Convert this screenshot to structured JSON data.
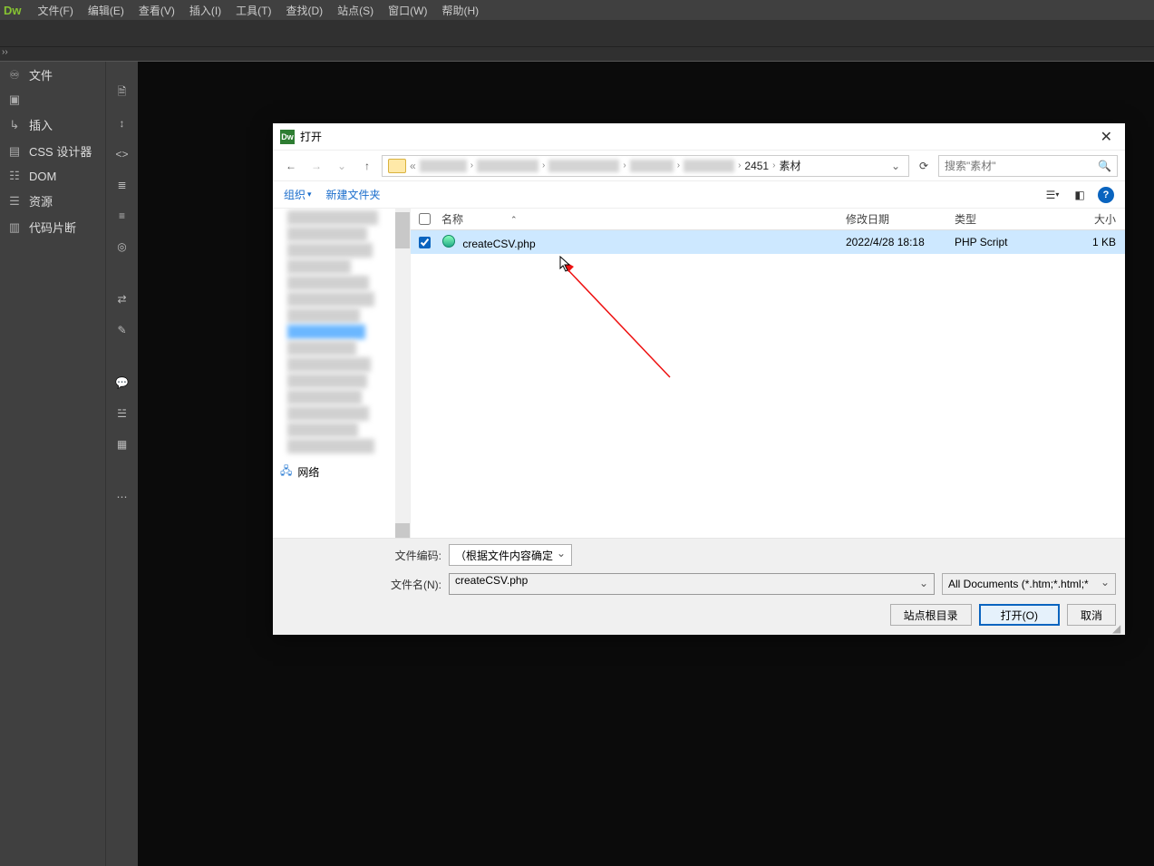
{
  "menubar": {
    "logo": "Dw",
    "items": [
      "文件(F)",
      "编辑(E)",
      "查看(V)",
      "插入(I)",
      "工具(T)",
      "查找(D)",
      "站点(S)",
      "窗口(W)",
      "帮助(H)"
    ]
  },
  "left_panel": {
    "items": [
      {
        "icon": "tree-icon",
        "label": "文件"
      },
      {
        "icon": "image-icon",
        "label": ""
      },
      {
        "icon": "insert-icon",
        "label": "插入"
      },
      {
        "icon": "css-icon",
        "label": "CSS 设计器"
      },
      {
        "icon": "dom-icon",
        "label": "DOM"
      },
      {
        "icon": "assets-icon",
        "label": "资源"
      },
      {
        "icon": "snippet-icon",
        "label": "代码片断"
      }
    ]
  },
  "dialog": {
    "title": "打开",
    "breadcrumb": {
      "part1": "2451",
      "part2": "素材"
    },
    "search_placeholder": "搜索\"素材\"",
    "toolbar": {
      "organize": "组织",
      "new_folder": "新建文件夹"
    },
    "columns": {
      "name": "名称",
      "date": "修改日期",
      "type": "类型",
      "size": "大小"
    },
    "file": {
      "name": "createCSV.php",
      "date": "2022/4/28 18:18",
      "type": "PHP Script",
      "size": "1 KB"
    },
    "tree_network": "网络",
    "encoding_label": "文件编码:",
    "encoding_value": "（根据文件内容确定",
    "filename_label": "文件名(N):",
    "filename_value": "createCSV.php",
    "filetype_value": "All Documents (*.htm;*.html;*",
    "btn_siteroot": "站点根目录",
    "btn_open": "打开(O)",
    "btn_cancel": "取消"
  }
}
